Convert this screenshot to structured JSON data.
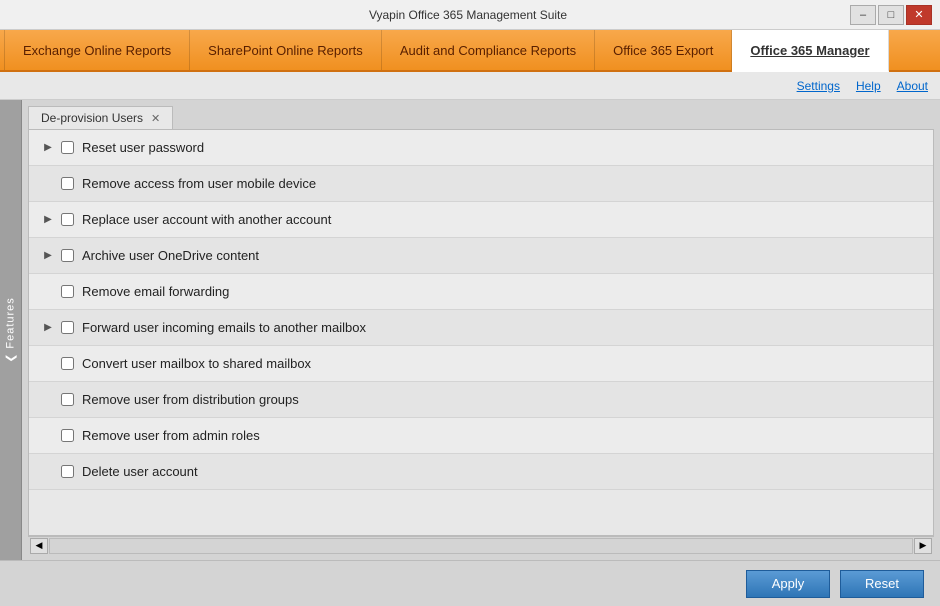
{
  "titleBar": {
    "title": "Vyapin Office 365 Management Suite",
    "minimizeLabel": "–",
    "maximizeLabel": "□",
    "closeLabel": "✕"
  },
  "navTabs": [
    {
      "id": "exchange",
      "label": "Exchange Online Reports",
      "active": false
    },
    {
      "id": "sharepoint",
      "label": "SharePoint Online Reports",
      "active": false
    },
    {
      "id": "audit",
      "label": "Audit and Compliance Reports",
      "active": false
    },
    {
      "id": "export",
      "label": "Office 365 Export",
      "active": false
    },
    {
      "id": "manager",
      "label": "Office 365 Manager",
      "active": true
    }
  ],
  "secondaryNav": [
    {
      "id": "settings",
      "label": "Settings"
    },
    {
      "id": "help",
      "label": "Help"
    },
    {
      "id": "about",
      "label": "About"
    }
  ],
  "featuresSidebar": {
    "label": "Features"
  },
  "activeTab": {
    "label": "De-provision Users",
    "closeIcon": "✕"
  },
  "checklistItems": [
    {
      "id": "item1",
      "hasExpand": true,
      "label": "Reset user password",
      "checked": false
    },
    {
      "id": "item2",
      "hasExpand": false,
      "label": "Remove access from user mobile device",
      "checked": false
    },
    {
      "id": "item3",
      "hasExpand": true,
      "label": "Replace user account with another account",
      "checked": false
    },
    {
      "id": "item4",
      "hasExpand": true,
      "label": "Archive user OneDrive content",
      "checked": false
    },
    {
      "id": "item5",
      "hasExpand": false,
      "label": "Remove email forwarding",
      "checked": false
    },
    {
      "id": "item6",
      "hasExpand": true,
      "label": "Forward user incoming emails to another mailbox",
      "checked": false
    },
    {
      "id": "item7",
      "hasExpand": false,
      "label": "Convert user mailbox to shared mailbox",
      "checked": false
    },
    {
      "id": "item8",
      "hasExpand": false,
      "label": "Remove user from distribution groups",
      "checked": false
    },
    {
      "id": "item9",
      "hasExpand": false,
      "label": "Remove user from admin roles",
      "checked": false
    },
    {
      "id": "item10",
      "hasExpand": false,
      "label": "Delete user account",
      "checked": false
    }
  ],
  "bottomBar": {
    "applyLabel": "Apply",
    "resetLabel": "Reset"
  }
}
